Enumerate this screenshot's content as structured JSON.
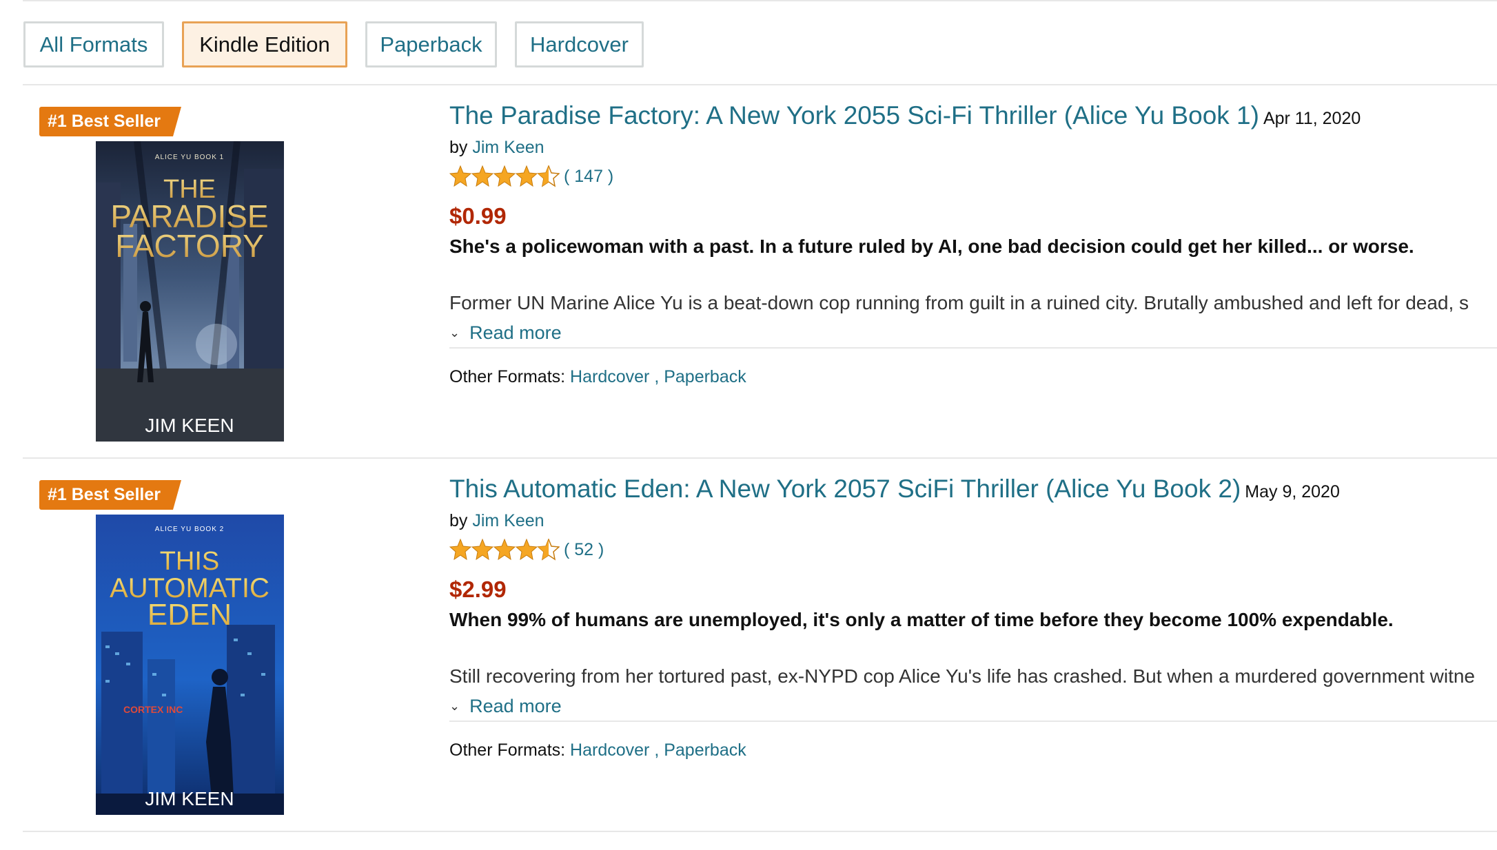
{
  "format_tabs": [
    {
      "label": "All Formats",
      "active": false
    },
    {
      "label": "Kindle Edition",
      "active": true
    },
    {
      "label": "Paperback",
      "active": false
    },
    {
      "label": "Hardcover",
      "active": false
    }
  ],
  "colors": {
    "link": "#1f6f86",
    "price": "#b12704",
    "badge": "#e47911",
    "star": "#f5a623",
    "active_tab_border": "#e8a255",
    "active_tab_bg": "#fdf1e3"
  },
  "books": [
    {
      "badge": "#1 Best Seller",
      "cover": {
        "series": "ALICE YU BOOK 1",
        "title_lines": [
          "THE",
          "PARADISE",
          "FACTORY"
        ],
        "author": "JIM KEEN"
      },
      "title": "The Paradise Factory: A New York 2055 Sci-Fi Thriller (Alice Yu Book 1)",
      "date": "Apr 11, 2020",
      "by_label": "by",
      "author": "Jim Keen",
      "rating": 4.5,
      "review_count": "( 147 )",
      "price": "$0.99",
      "tagline": "She's a policewoman with a past. In a future ruled by AI, one bad decision could get her killed... or worse.",
      "description": "Former UN Marine Alice Yu is a beat-down cop running from guilt in a ruined city. Brutally ambushed and left for dead, s",
      "read_more": "Read more",
      "other_formats_label": "Other Formats:",
      "other_formats": [
        "Hardcover",
        "Paperback"
      ]
    },
    {
      "badge": "#1 Best Seller",
      "cover": {
        "series": "ALICE YU BOOK 2",
        "title_lines": [
          "THIS",
          "AUTOMATIC",
          "EDEN"
        ],
        "author": "JIM KEEN"
      },
      "title": "This Automatic Eden: A New York 2057 SciFi Thriller (Alice Yu Book 2)",
      "date": "May 9, 2020",
      "by_label": "by",
      "author": "Jim Keen",
      "rating": 4.5,
      "review_count": "( 52 )",
      "price": "$2.99",
      "tagline": "When 99% of humans are unemployed, it's only a matter of time before they become 100% expendable.",
      "description": "Still recovering from her tortured past, ex-NYPD cop Alice Yu's life has crashed. But when a murdered government witne",
      "read_more": "Read more",
      "other_formats_label": "Other Formats:",
      "other_formats": [
        "Hardcover",
        "Paperback"
      ]
    }
  ]
}
